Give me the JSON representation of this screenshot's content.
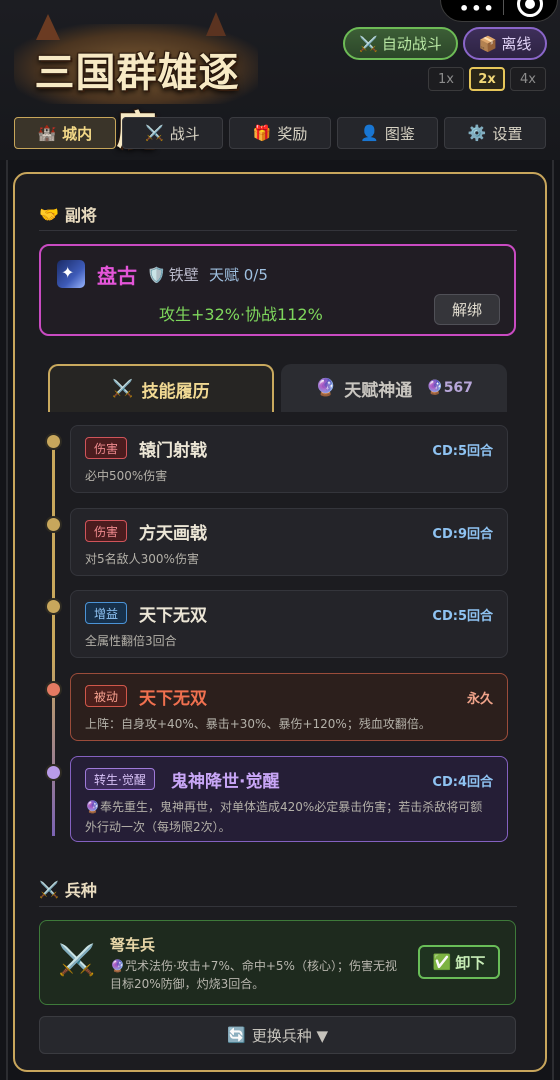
{
  "header": {
    "logo_text": "三国群雄逐鹿",
    "auto_battle_label": "自动战斗",
    "offline_label": "离线",
    "speeds": [
      "1x",
      "2x",
      "4x"
    ],
    "active_speed": "2x",
    "miniapp_dots": "•••"
  },
  "tabs": [
    {
      "icon": "🏰",
      "label": "城内",
      "active": true
    },
    {
      "icon": "⚔️",
      "label": "战斗",
      "active": false
    },
    {
      "icon": "🎁",
      "label": "奖励",
      "active": false
    },
    {
      "icon": "👤",
      "label": "图鉴",
      "active": false
    },
    {
      "icon": "⚙️",
      "label": "设置",
      "active": false
    }
  ],
  "deputy": {
    "section_icon": "🤝",
    "section_title": "副将",
    "name": "盘古",
    "trait_icon": "🛡️",
    "trait": "铁壁",
    "talent": "天赋 0/5",
    "bonus": "攻生+32%·协战112%",
    "unbind_label": "解绑"
  },
  "sub_tabs": {
    "skills_icon": "⚔️",
    "skills_label": "技能履历",
    "talent_icon": "🔮",
    "talent_label": "天赋神通",
    "talent_count_icon": "🔮",
    "talent_count": "567"
  },
  "skills": [
    {
      "tag": "伤害",
      "tag_type": "dmg",
      "name": "辕门射戟",
      "cd": "CD:5回合",
      "desc": "必中500%伤害",
      "dot_color": "#c8a75c"
    },
    {
      "tag": "伤害",
      "tag_type": "dmg",
      "name": "方天画戟",
      "cd": "CD:9回合",
      "desc": "对5名敌人300%伤害",
      "dot_color": "#c8a75c"
    },
    {
      "tag": "增益",
      "tag_type": "buff",
      "name": "天下无双",
      "cd": "CD:5回合",
      "desc": "全属性翻倍3回合",
      "dot_color": "#c8a75c"
    },
    {
      "tag": "被动",
      "tag_type": "pas",
      "name": "天下无双",
      "cd": "永久",
      "desc": "上阵：自身攻+40%、暴击+30%、暴伤+120%；残血攻翻倍。",
      "dot_color": "#e57a62"
    },
    {
      "tag": "转生·觉醒",
      "tag_type": "awk",
      "name": "鬼神降世·觉醒",
      "cd": "CD:4回合",
      "desc": "🔮奉先重生，鬼神再世，对单体造成420%必定暴击伤害；若击杀敌将可额外行动一次（每场限2次）。",
      "dot_color": "#b89be8"
    }
  ],
  "troops": {
    "section_icon": "⚔️",
    "section_title": "兵种",
    "icon": "⚔️",
    "name": "弩车兵",
    "desc": "🔮咒术法伤·攻击+7%、命中+5%（核心）；伤害无视目标20%防御，灼烧3回合。",
    "unequip_icon": "✅",
    "unequip_label": "卸下",
    "change_icon": "🔄",
    "change_label": "更换兵种 ▼"
  },
  "colors": {
    "accent_gold": "#c8a65c",
    "deputy_border": "#c94bc2",
    "auto_green": "#6dbb56",
    "offline_purple": "#8a66c9"
  }
}
